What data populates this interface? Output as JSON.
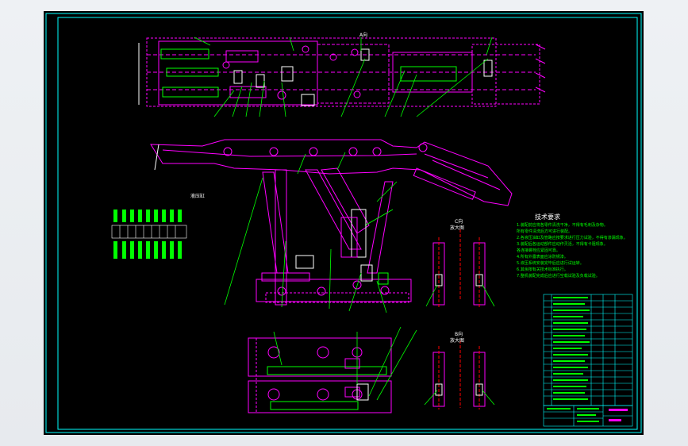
{
  "drawing": {
    "technical_requirements_title": "技术要求",
    "technical_requirements": [
      "1.装配前应将各零件清洗干净，不得有毛刺及杂物。",
      "  所有零件清洗后方可进行装配。",
      "2.各液压油缸及管路应按要求进行压力试验，不得有渗漏现象。",
      "3.装配后各运动部件应动作灵活，不得有卡阻现象。",
      "  各连接螺栓应紧固可靠。",
      "4.所有外露表面应涂防锈漆。",
      "5.液压系统安装完毕后应进行试运转。",
      "6.其余按有关技术标准执行。",
      "7.整机装配完成后应进行空载试验及负载试验。"
    ],
    "view_labels": {
      "top_view_a": "A向",
      "view_c": "C向",
      "view_c_sub": "放大图",
      "view_b": "B向",
      "view_b_sub": "放大图",
      "legend_title": "液压缸"
    }
  },
  "colors": {
    "sheet_bg": "#000000",
    "frame": "#00ffff",
    "part": "#ff00ff",
    "leader": "#00ff00",
    "text": "#ffffff",
    "title_block": "#00ffff"
  }
}
